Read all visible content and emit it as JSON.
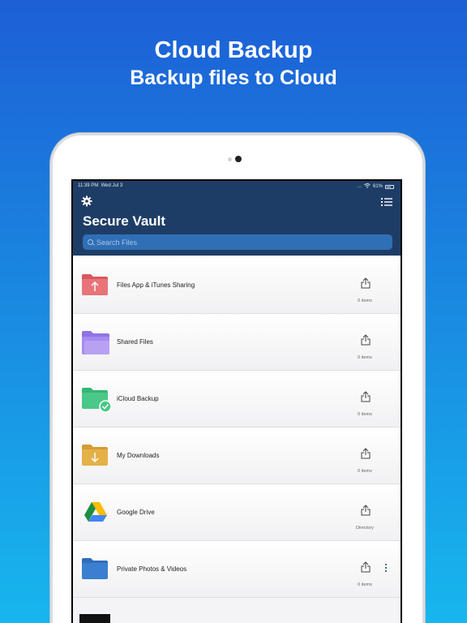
{
  "headline": {
    "title": "Cloud Backup",
    "subtitle": "Backup files to Cloud"
  },
  "statusbar": {
    "time": "11:39 PM",
    "date": "Wed Jul 3",
    "signal": "...",
    "battery": "61%"
  },
  "navbar": {
    "title": "Secure Vault",
    "settings_icon": "gear-icon",
    "view_icon": "list-icon"
  },
  "search": {
    "placeholder": "Search Files"
  },
  "folders": [
    {
      "label": "Files App & iTunes Sharing",
      "count": "0 items",
      "color": "#e8747a",
      "icon": "folder-upload-icon"
    },
    {
      "label": "Shared Files",
      "count": "0 items",
      "color": "#a58bee",
      "icon": "folder-stack-icon"
    },
    {
      "label": "iCloud Backup",
      "count": "0 items",
      "color": "#4ac887",
      "icon": "folder-check-icon"
    },
    {
      "label": "My Downloads",
      "count": "0 items",
      "color": "#e4b048",
      "icon": "folder-download-icon"
    },
    {
      "label": "Google Drive",
      "count": "Directory",
      "color": "#1e8e3e",
      "icon": "google-drive-icon"
    },
    {
      "label": "Private Photos & Videos",
      "count": "0 items",
      "color": "#3a7fd0",
      "icon": "folder-icon"
    }
  ],
  "colors": {
    "background_top": "#1d5fd6",
    "background_bottom": "#17b6ee",
    "navbar": "#1e3d66",
    "search": "#2f6fb5"
  }
}
